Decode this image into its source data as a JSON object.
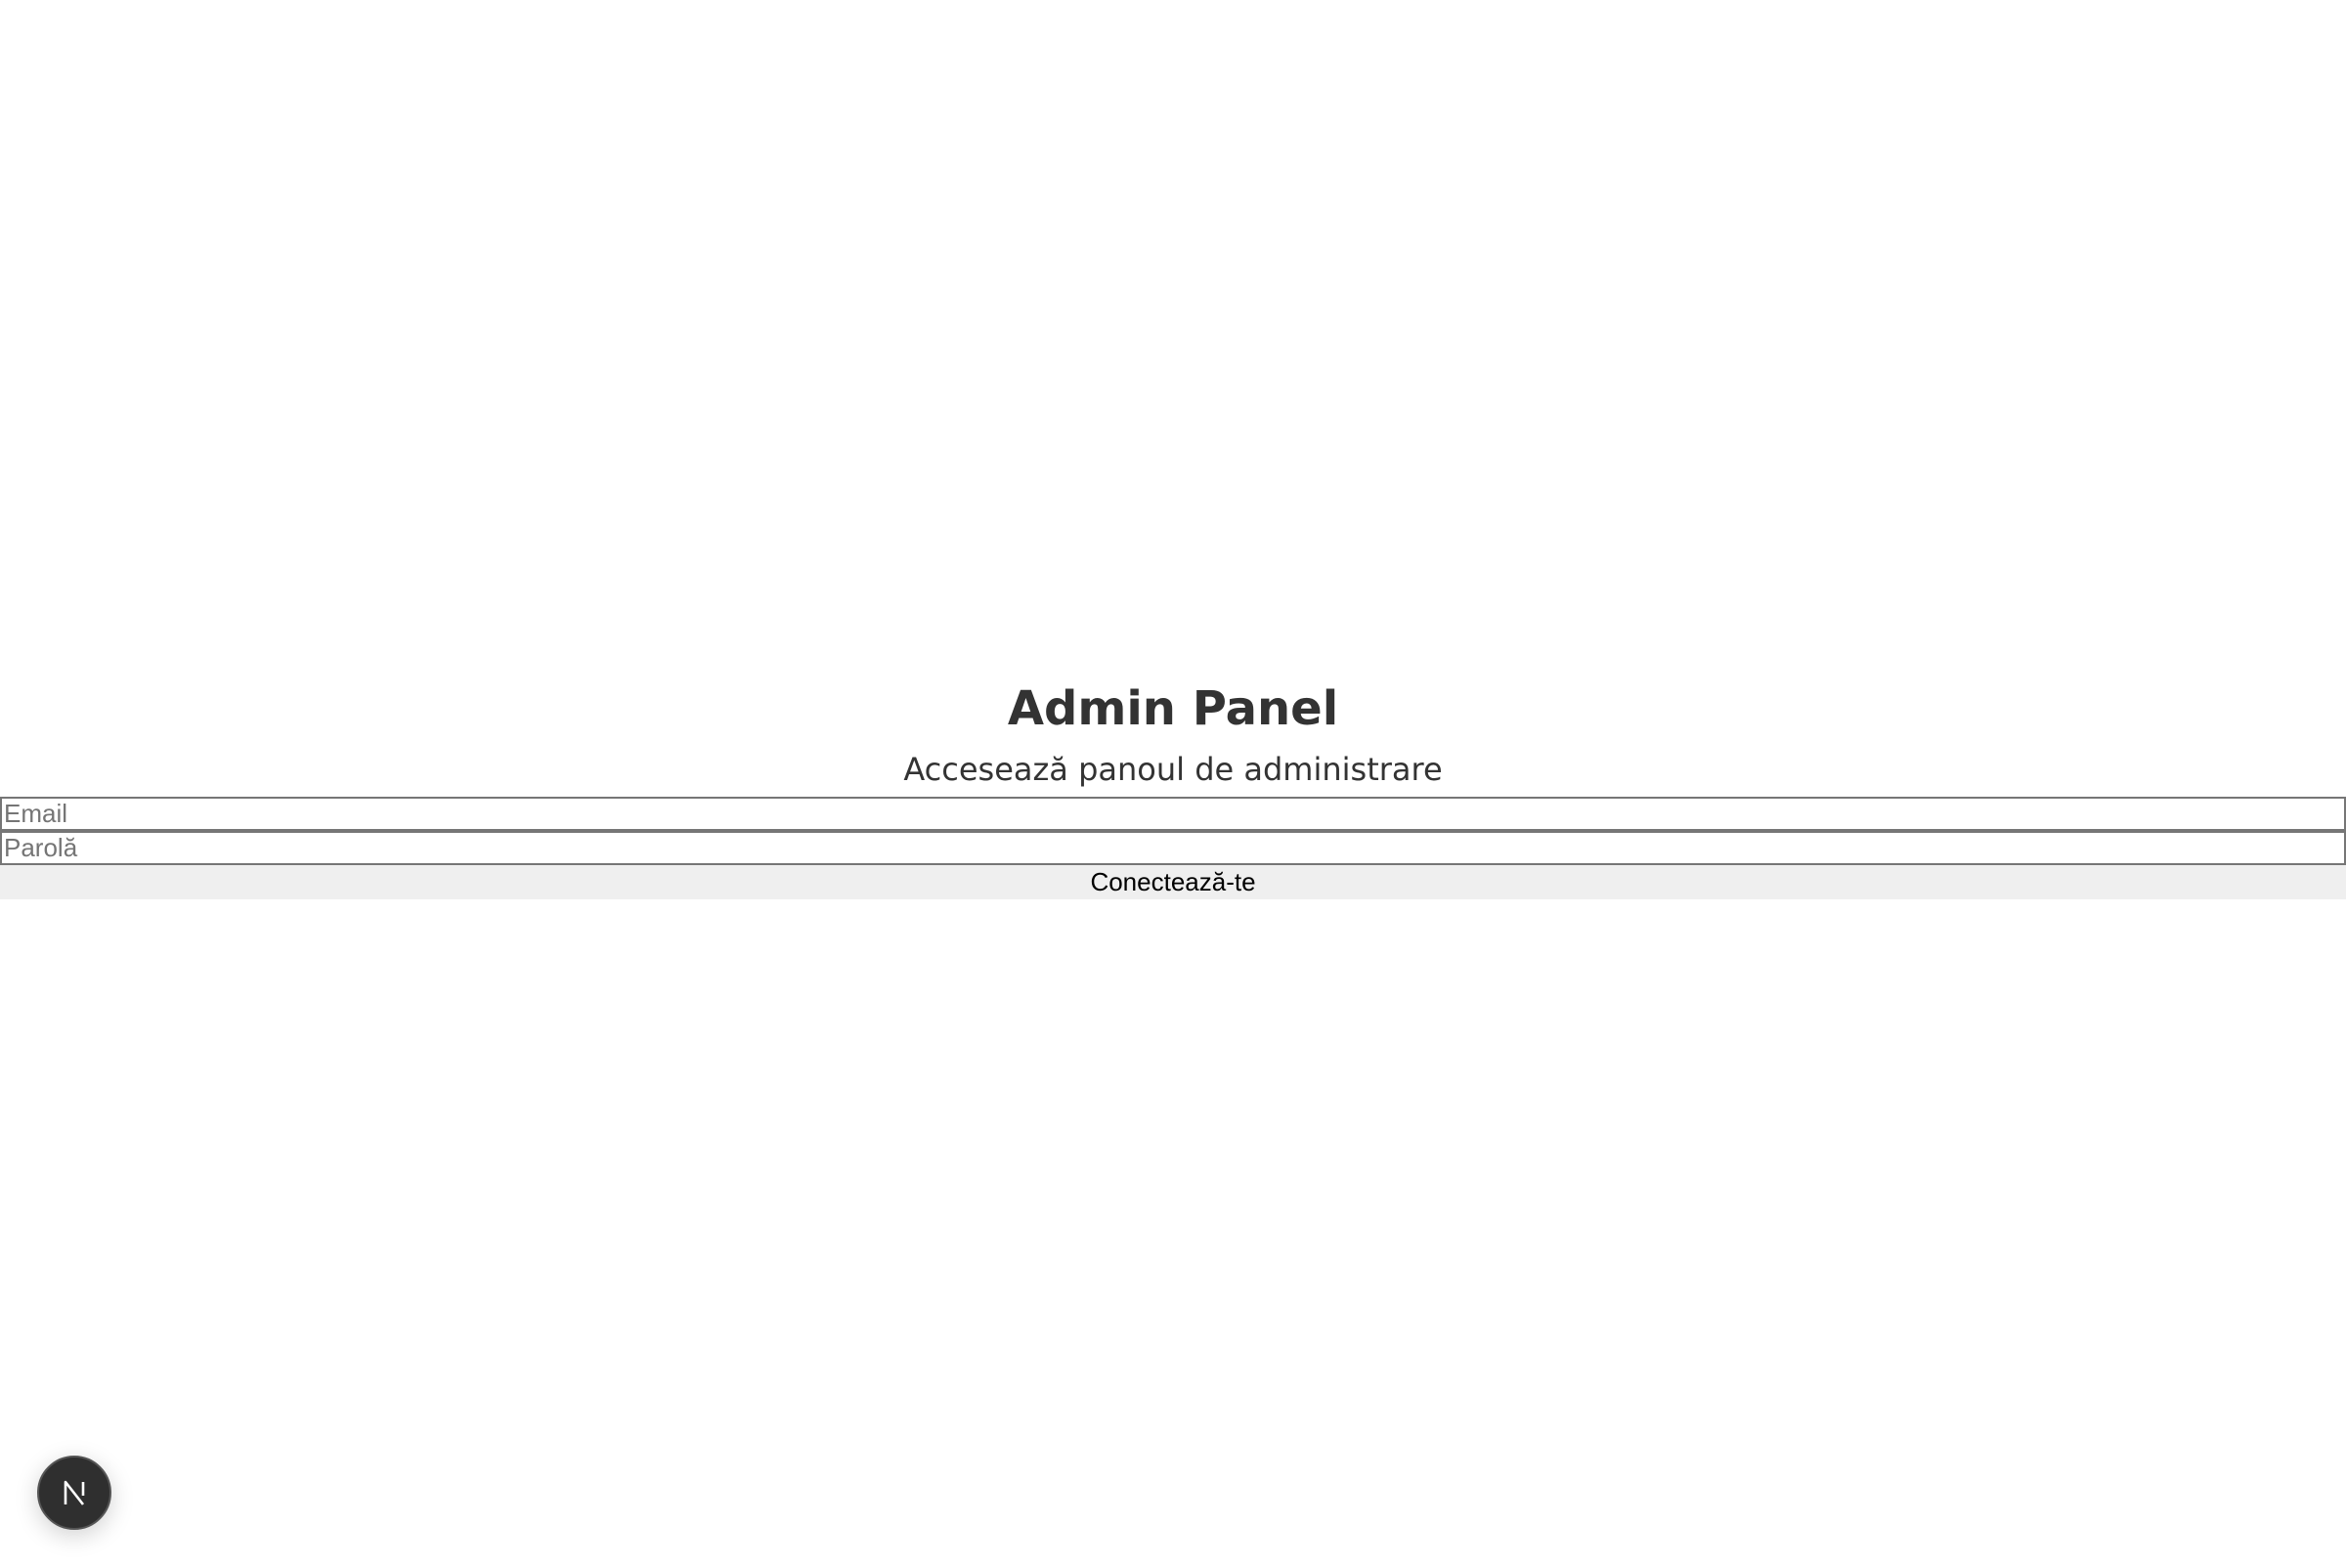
{
  "header": {
    "title": "Admin Panel",
    "subtitle": "Accesează panoul de administrare"
  },
  "form": {
    "email": {
      "value": "",
      "placeholder": "Email"
    },
    "password": {
      "value": "",
      "placeholder": "Parolă"
    },
    "submit_label": "Conectează-te"
  },
  "dev_indicator": {
    "icon": "nextjs-logo-icon",
    "bg_color": "#2f2f2f"
  }
}
